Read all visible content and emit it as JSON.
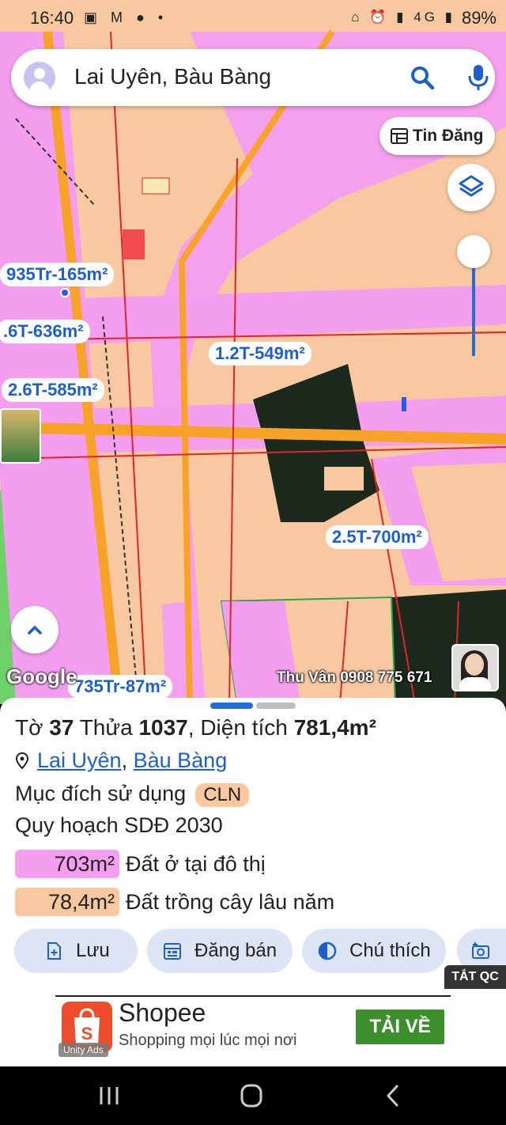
{
  "status_bar": {
    "time": "16:40",
    "left_icons": "▣ M ● •",
    "right_icons": "⌂ ⏰ ▮ 4G ▮",
    "battery": "89%"
  },
  "search": {
    "query": "Lai Uyên, Bàu Bàng"
  },
  "map": {
    "listings_button": "Tin Đăng",
    "labels": [
      "935Tr-165m²",
      ".6T-636m²",
      "1.2T-549m²",
      "2.6T-585m²",
      "2.5T-700m²",
      "735Tr-87m²"
    ],
    "google_logo": "Google",
    "contact": "Thu Vân 0908 775 671",
    "zoom_level": 0.2
  },
  "sheet": {
    "title_prefix": "Tờ",
    "sheet_no": "37",
    "parcel_prefix": "Thửa",
    "parcel_no": "1037",
    "area_prefix": ", Diện tích",
    "area_value": "781,4m²",
    "location_1": "Lai Uyên",
    "location_sep": ",",
    "location_2": "Bàu Bàng",
    "purpose_label": "Mục đích sử dụng",
    "purpose_code": "CLN",
    "plan_label": "Quy hoạch SDĐ 2030",
    "land_uses": [
      {
        "area": "703m²",
        "desc": "Đất ở tại đô thị",
        "color": "#f49ef0"
      },
      {
        "area": "78,4m²",
        "desc": "Đất trồng cây lâu năm",
        "color": "#f8c9a0"
      }
    ],
    "actions": [
      {
        "label": "Lưu",
        "icon": "save-icon"
      },
      {
        "label": "Đăng bán",
        "icon": "calendar-icon"
      },
      {
        "label": "Chú thích",
        "icon": "legend-icon"
      },
      {
        "label": "",
        "icon": "camera-icon"
      }
    ]
  },
  "ad": {
    "tag": "TẮT QC",
    "brand": "Shopee",
    "slogan": "Shopping mọi lúc mọi nơi",
    "install": "TẢI VỀ",
    "network": "Unity Ads"
  },
  "colors": {
    "accent": "#1f5fc9",
    "residential": "#f49ef0",
    "perennial": "#f8c9a0",
    "road": "#f7a327"
  }
}
